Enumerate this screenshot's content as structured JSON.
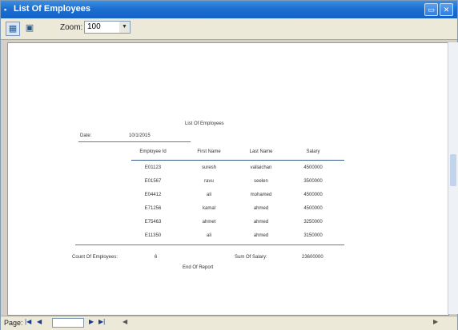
{
  "window": {
    "title": "List Of Employees"
  },
  "toolbar": {
    "zoom_label": "Zoom:",
    "zoom_value": "100"
  },
  "report": {
    "title": "List Of Employees",
    "date_label": "Date:",
    "date_value": "10/1/2015",
    "columns": [
      "Employee Id",
      "First Name",
      "Last Name",
      "Salary"
    ],
    "rows": [
      [
        "E01123",
        "suresh",
        "vallaichan",
        "4500000"
      ],
      [
        "E01567",
        "ravu",
        "seelen",
        "3500000"
      ],
      [
        "E04412",
        "ali",
        "mohamed",
        "4500000"
      ],
      [
        "E71256",
        "kamal",
        "ahmed",
        "4500000"
      ],
      [
        "E75463",
        "ahmet",
        "ahmed",
        "3250000"
      ],
      [
        "E11350",
        "ali",
        "ahmed",
        "3150000"
      ]
    ],
    "count_label": "Count Of Employees:",
    "count_value": "6",
    "sum_label": "Sum Of Salary:",
    "sum_value": "23600000",
    "end_label": "End Of Report"
  },
  "statusbar": {
    "page_label": "Page:"
  },
  "icons": [
    "app-icon",
    "minimize-icon",
    "close-icon",
    "print-icon",
    "export-icon",
    "first-page-icon",
    "prev-page-icon",
    "next-page-icon",
    "last-page-icon"
  ]
}
